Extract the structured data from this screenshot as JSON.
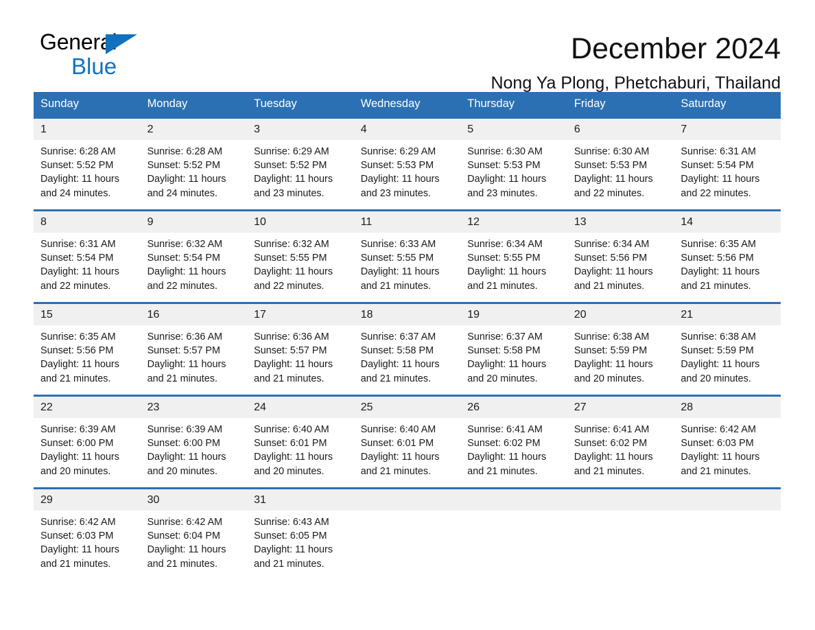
{
  "brand": {
    "name_part1": "General",
    "name_part2": "Blue",
    "triangle_icon": "brand-triangle-icon",
    "colors": {
      "blue": "#1271BC",
      "black": "#000000"
    }
  },
  "header": {
    "month_title": "December 2024",
    "location": "Nong Ya Plong, Phetchaburi, Thailand"
  },
  "theme": {
    "header_blue": "#2B70B3",
    "daynum_band": "#F0F0F0",
    "text": "#1a1a1a",
    "page_background": "#ffffff"
  },
  "columns": [
    "Sunday",
    "Monday",
    "Tuesday",
    "Wednesday",
    "Thursday",
    "Friday",
    "Saturday"
  ],
  "weeks": [
    [
      {
        "day": "1",
        "sunrise": "Sunrise: 6:28 AM",
        "sunset": "Sunset: 5:52 PM",
        "daylight_line1": "Daylight: 11 hours",
        "daylight_line2": "and 24 minutes."
      },
      {
        "day": "2",
        "sunrise": "Sunrise: 6:28 AM",
        "sunset": "Sunset: 5:52 PM",
        "daylight_line1": "Daylight: 11 hours",
        "daylight_line2": "and 24 minutes."
      },
      {
        "day": "3",
        "sunrise": "Sunrise: 6:29 AM",
        "sunset": "Sunset: 5:52 PM",
        "daylight_line1": "Daylight: 11 hours",
        "daylight_line2": "and 23 minutes."
      },
      {
        "day": "4",
        "sunrise": "Sunrise: 6:29 AM",
        "sunset": "Sunset: 5:53 PM",
        "daylight_line1": "Daylight: 11 hours",
        "daylight_line2": "and 23 minutes."
      },
      {
        "day": "5",
        "sunrise": "Sunrise: 6:30 AM",
        "sunset": "Sunset: 5:53 PM",
        "daylight_line1": "Daylight: 11 hours",
        "daylight_line2": "and 23 minutes."
      },
      {
        "day": "6",
        "sunrise": "Sunrise: 6:30 AM",
        "sunset": "Sunset: 5:53 PM",
        "daylight_line1": "Daylight: 11 hours",
        "daylight_line2": "and 22 minutes."
      },
      {
        "day": "7",
        "sunrise": "Sunrise: 6:31 AM",
        "sunset": "Sunset: 5:54 PM",
        "daylight_line1": "Daylight: 11 hours",
        "daylight_line2": "and 22 minutes."
      }
    ],
    [
      {
        "day": "8",
        "sunrise": "Sunrise: 6:31 AM",
        "sunset": "Sunset: 5:54 PM",
        "daylight_line1": "Daylight: 11 hours",
        "daylight_line2": "and 22 minutes."
      },
      {
        "day": "9",
        "sunrise": "Sunrise: 6:32 AM",
        "sunset": "Sunset: 5:54 PM",
        "daylight_line1": "Daylight: 11 hours",
        "daylight_line2": "and 22 minutes."
      },
      {
        "day": "10",
        "sunrise": "Sunrise: 6:32 AM",
        "sunset": "Sunset: 5:55 PM",
        "daylight_line1": "Daylight: 11 hours",
        "daylight_line2": "and 22 minutes."
      },
      {
        "day": "11",
        "sunrise": "Sunrise: 6:33 AM",
        "sunset": "Sunset: 5:55 PM",
        "daylight_line1": "Daylight: 11 hours",
        "daylight_line2": "and 21 minutes."
      },
      {
        "day": "12",
        "sunrise": "Sunrise: 6:34 AM",
        "sunset": "Sunset: 5:55 PM",
        "daylight_line1": "Daylight: 11 hours",
        "daylight_line2": "and 21 minutes."
      },
      {
        "day": "13",
        "sunrise": "Sunrise: 6:34 AM",
        "sunset": "Sunset: 5:56 PM",
        "daylight_line1": "Daylight: 11 hours",
        "daylight_line2": "and 21 minutes."
      },
      {
        "day": "14",
        "sunrise": "Sunrise: 6:35 AM",
        "sunset": "Sunset: 5:56 PM",
        "daylight_line1": "Daylight: 11 hours",
        "daylight_line2": "and 21 minutes."
      }
    ],
    [
      {
        "day": "15",
        "sunrise": "Sunrise: 6:35 AM",
        "sunset": "Sunset: 5:56 PM",
        "daylight_line1": "Daylight: 11 hours",
        "daylight_line2": "and 21 minutes."
      },
      {
        "day": "16",
        "sunrise": "Sunrise: 6:36 AM",
        "sunset": "Sunset: 5:57 PM",
        "daylight_line1": "Daylight: 11 hours",
        "daylight_line2": "and 21 minutes."
      },
      {
        "day": "17",
        "sunrise": "Sunrise: 6:36 AM",
        "sunset": "Sunset: 5:57 PM",
        "daylight_line1": "Daylight: 11 hours",
        "daylight_line2": "and 21 minutes."
      },
      {
        "day": "18",
        "sunrise": "Sunrise: 6:37 AM",
        "sunset": "Sunset: 5:58 PM",
        "daylight_line1": "Daylight: 11 hours",
        "daylight_line2": "and 21 minutes."
      },
      {
        "day": "19",
        "sunrise": "Sunrise: 6:37 AM",
        "sunset": "Sunset: 5:58 PM",
        "daylight_line1": "Daylight: 11 hours",
        "daylight_line2": "and 20 minutes."
      },
      {
        "day": "20",
        "sunrise": "Sunrise: 6:38 AM",
        "sunset": "Sunset: 5:59 PM",
        "daylight_line1": "Daylight: 11 hours",
        "daylight_line2": "and 20 minutes."
      },
      {
        "day": "21",
        "sunrise": "Sunrise: 6:38 AM",
        "sunset": "Sunset: 5:59 PM",
        "daylight_line1": "Daylight: 11 hours",
        "daylight_line2": "and 20 minutes."
      }
    ],
    [
      {
        "day": "22",
        "sunrise": "Sunrise: 6:39 AM",
        "sunset": "Sunset: 6:00 PM",
        "daylight_line1": "Daylight: 11 hours",
        "daylight_line2": "and 20 minutes."
      },
      {
        "day": "23",
        "sunrise": "Sunrise: 6:39 AM",
        "sunset": "Sunset: 6:00 PM",
        "daylight_line1": "Daylight: 11 hours",
        "daylight_line2": "and 20 minutes."
      },
      {
        "day": "24",
        "sunrise": "Sunrise: 6:40 AM",
        "sunset": "Sunset: 6:01 PM",
        "daylight_line1": "Daylight: 11 hours",
        "daylight_line2": "and 20 minutes."
      },
      {
        "day": "25",
        "sunrise": "Sunrise: 6:40 AM",
        "sunset": "Sunset: 6:01 PM",
        "daylight_line1": "Daylight: 11 hours",
        "daylight_line2": "and 21 minutes."
      },
      {
        "day": "26",
        "sunrise": "Sunrise: 6:41 AM",
        "sunset": "Sunset: 6:02 PM",
        "daylight_line1": "Daylight: 11 hours",
        "daylight_line2": "and 21 minutes."
      },
      {
        "day": "27",
        "sunrise": "Sunrise: 6:41 AM",
        "sunset": "Sunset: 6:02 PM",
        "daylight_line1": "Daylight: 11 hours",
        "daylight_line2": "and 21 minutes."
      },
      {
        "day": "28",
        "sunrise": "Sunrise: 6:42 AM",
        "sunset": "Sunset: 6:03 PM",
        "daylight_line1": "Daylight: 11 hours",
        "daylight_line2": "and 21 minutes."
      }
    ],
    [
      {
        "day": "29",
        "sunrise": "Sunrise: 6:42 AM",
        "sunset": "Sunset: 6:03 PM",
        "daylight_line1": "Daylight: 11 hours",
        "daylight_line2": "and 21 minutes."
      },
      {
        "day": "30",
        "sunrise": "Sunrise: 6:42 AM",
        "sunset": "Sunset: 6:04 PM",
        "daylight_line1": "Daylight: 11 hours",
        "daylight_line2": "and 21 minutes."
      },
      {
        "day": "31",
        "sunrise": "Sunrise: 6:43 AM",
        "sunset": "Sunset: 6:05 PM",
        "daylight_line1": "Daylight: 11 hours",
        "daylight_line2": "and 21 minutes."
      },
      {
        "day": "",
        "sunrise": "",
        "sunset": "",
        "daylight_line1": "",
        "daylight_line2": ""
      },
      {
        "day": "",
        "sunrise": "",
        "sunset": "",
        "daylight_line1": "",
        "daylight_line2": ""
      },
      {
        "day": "",
        "sunrise": "",
        "sunset": "",
        "daylight_line1": "",
        "daylight_line2": ""
      },
      {
        "day": "",
        "sunrise": "",
        "sunset": "",
        "daylight_line1": "",
        "daylight_line2": ""
      }
    ]
  ]
}
